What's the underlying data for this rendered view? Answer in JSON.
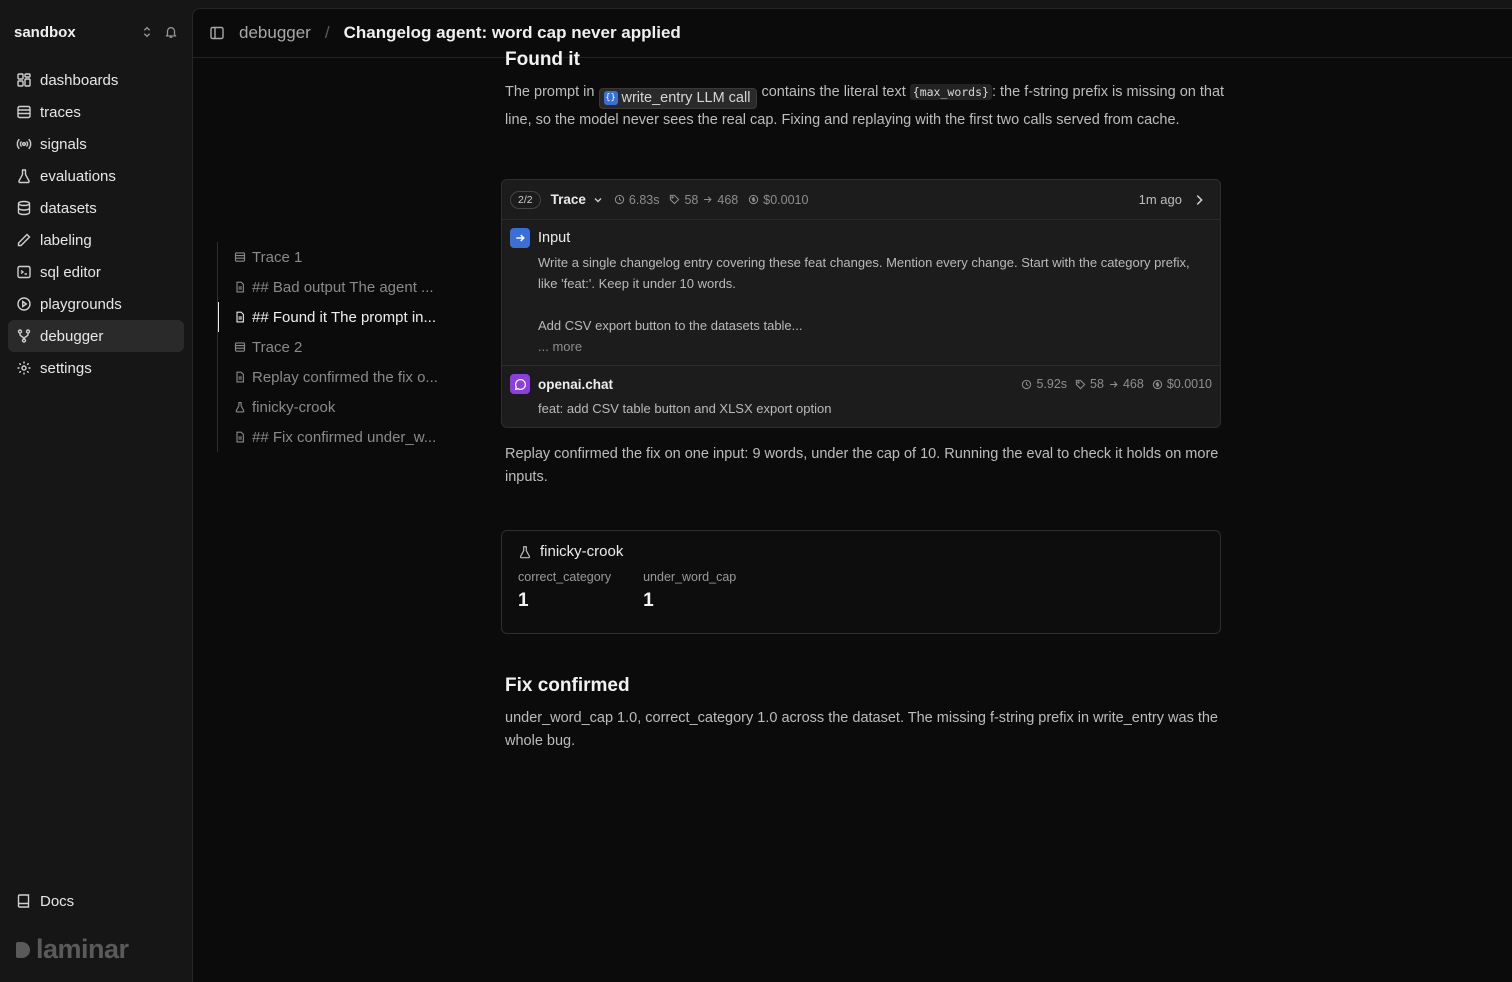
{
  "workspace": {
    "name": "sandbox"
  },
  "nav": {
    "items": [
      {
        "label": "dashboards",
        "icon": "grid-icon"
      },
      {
        "label": "traces",
        "icon": "list-icon"
      },
      {
        "label": "signals",
        "icon": "broadcast-icon"
      },
      {
        "label": "evaluations",
        "icon": "flask-icon"
      },
      {
        "label": "datasets",
        "icon": "database-icon"
      },
      {
        "label": "labeling",
        "icon": "pen-icon"
      },
      {
        "label": "sql editor",
        "icon": "terminal-icon"
      },
      {
        "label": "playgrounds",
        "icon": "play-icon"
      },
      {
        "label": "debugger",
        "icon": "git-branch-icon",
        "active": true
      },
      {
        "label": "settings",
        "icon": "gear-icon"
      }
    ],
    "docs_label": "Docs"
  },
  "brand": {
    "name": "laminar"
  },
  "header": {
    "section": "debugger",
    "separator": "/",
    "title": "Changelog agent: word cap never applied"
  },
  "toc": {
    "items": [
      {
        "label": "Trace 1",
        "icon": "list-icon"
      },
      {
        "label": "## Bad output The agent ...",
        "icon": "file-icon"
      },
      {
        "label": "## Found it The prompt in...",
        "icon": "file-icon",
        "active": true
      },
      {
        "label": "Trace 2",
        "icon": "list-icon"
      },
      {
        "label": "Replay confirmed the fix o...",
        "icon": "file-icon"
      },
      {
        "label": "finicky-crook",
        "icon": "flask-icon"
      },
      {
        "label": "## Fix confirmed under_w...",
        "icon": "file-icon"
      }
    ]
  },
  "found_it": {
    "heading": "Found it",
    "text_1": "The prompt in",
    "chip": "write_entry LLM call",
    "text_2": "contains the literal text",
    "code": "{max_words}",
    "text_3": ": the f-string prefix is missing on that line, so the model never sees the real cap. Fixing and replaying with the first two calls served from cache."
  },
  "trace_card": {
    "pill": "2/2",
    "label": "Trace",
    "duration": "6.83s",
    "tokens_in": "58",
    "tokens_out": "468",
    "cost": "$0.0010",
    "ago": "1m ago",
    "input": {
      "name": "Input",
      "line_1": "Write a single changelog entry covering these feat changes. Mention every change. Start with the category prefix, like 'feat:'. Keep it under 10 words.",
      "line_2": "Add CSV export button to the datasets table...",
      "more": "... more"
    },
    "llm": {
      "name": "openai.chat",
      "duration": "5.92s",
      "tokens_in": "58",
      "tokens_out": "468",
      "cost": "$0.0010",
      "output": "feat: add CSV table button and XLSX export option"
    }
  },
  "replay_text": "Replay confirmed the fix on one input: 9 words, under the cap of 10. Running the eval to check it holds on more inputs.",
  "eval_card": {
    "name": "finicky-crook",
    "scores": [
      {
        "label": "correct_category",
        "value": "1"
      },
      {
        "label": "under_word_cap",
        "value": "1"
      }
    ]
  },
  "fix_confirmed": {
    "heading": "Fix confirmed",
    "text": "under_word_cap 1.0, correct_category 1.0 across the dataset. The missing f-string prefix in write_entry was the whole bug."
  }
}
